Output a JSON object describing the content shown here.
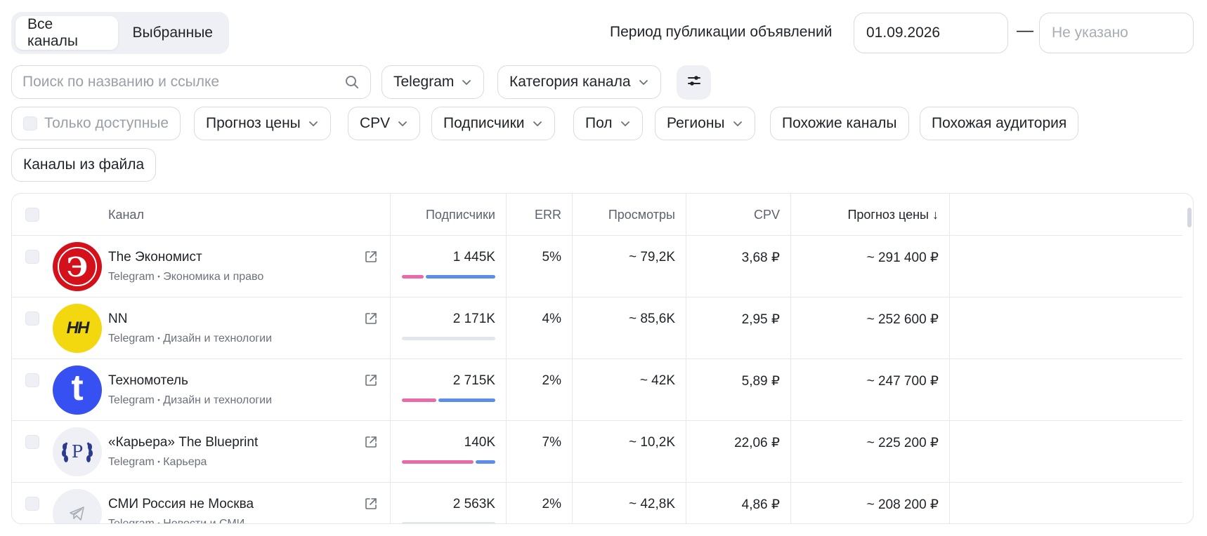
{
  "tabs": [
    {
      "label": "Все каналы",
      "active": true
    },
    {
      "label": "Выбранные",
      "active": false
    }
  ],
  "period": {
    "label": "Период публикации объявлений",
    "from": "01.09.2026",
    "dash": "—",
    "to_placeholder": "Не указано"
  },
  "search": {
    "placeholder": "Поиск по названию и ссылке"
  },
  "filters_row1": {
    "platform": "Telegram",
    "category": "Категория канала",
    "settings_icon": "sliders-icon"
  },
  "filters_row2": {
    "only_available": "Только доступные",
    "price_forecast": "Прогноз цены",
    "cpv": "CPV",
    "subscribers": "Подписчики",
    "gender": "Пол",
    "regions": "Регионы",
    "similar_channels": "Похожие каналы",
    "similar_audience": "Похожая аудитория",
    "from_file": "Каналы из файла"
  },
  "table": {
    "headers": {
      "channel": "Канал",
      "subscribers": "Подписчики",
      "err": "ERR",
      "views": "Просмотры",
      "cpv": "CPV",
      "price": "Прогноз цены ↓"
    },
    "separator": "•",
    "rows": [
      {
        "name": "The Экономист",
        "platform": "Telegram",
        "category": "Экономика и право",
        "subscribers": "1 445K",
        "female_share": 0.25,
        "male_share": 0.75,
        "err": "5%",
        "views": "~ 79,2K",
        "cpv": "3,68 ₽",
        "price": "~ 291 400 ₽",
        "avatar": "economist-logo",
        "avatar_letter": "Э"
      },
      {
        "name": "NN",
        "platform": "Telegram",
        "category": "Дизайн и технологии",
        "subscribers": "2 171K",
        "female_share": 0,
        "male_share": 0,
        "err": "4%",
        "views": "~ 85,6K",
        "cpv": "2,95 ₽",
        "price": "~ 252 600 ₽",
        "avatar": "hh-logo",
        "avatar_letter": "HH"
      },
      {
        "name": "Техномотель",
        "platform": "Telegram",
        "category": "Дизайн и технологии",
        "subscribers": "2 715K",
        "female_share": 0.38,
        "male_share": 0.62,
        "err": "2%",
        "views": "~ 42K",
        "cpv": "5,89 ₽",
        "price": "~ 247 700 ₽",
        "avatar": "technomotel-logo",
        "avatar_letter": "t"
      },
      {
        "name": "«Карьера» The Blueprint",
        "platform": "Telegram",
        "category": "Карьера",
        "subscribers": "140K",
        "female_share": 0.78,
        "male_share": 0.22,
        "err": "7%",
        "views": "~ 10,2K",
        "cpv": "22,06 ₽",
        "price": "~ 225 200 ₽",
        "avatar": "blueprint-logo",
        "avatar_letter": "P"
      },
      {
        "name": "СМИ Россия не Москва",
        "platform": "Telegram",
        "category": "Новости и СМИ",
        "subscribers": "2 563K",
        "female_share": 0,
        "male_share": 0,
        "err": "2%",
        "views": "~ 42,8K",
        "cpv": "4,86 ₽",
        "price": "~ 208 200 ₽",
        "avatar": "telegram-placeholder",
        "avatar_letter": ""
      }
    ]
  },
  "colors": {
    "female_bar": "#ea6aa8",
    "male_bar": "#5b8def",
    "empty_bar": "#e3e6ec",
    "economist_red": "#d4111b",
    "hh_yellow": "#f4d80f",
    "technomotel_blue": "#3650f2",
    "blueprint_navy": "#2b3a8f"
  }
}
